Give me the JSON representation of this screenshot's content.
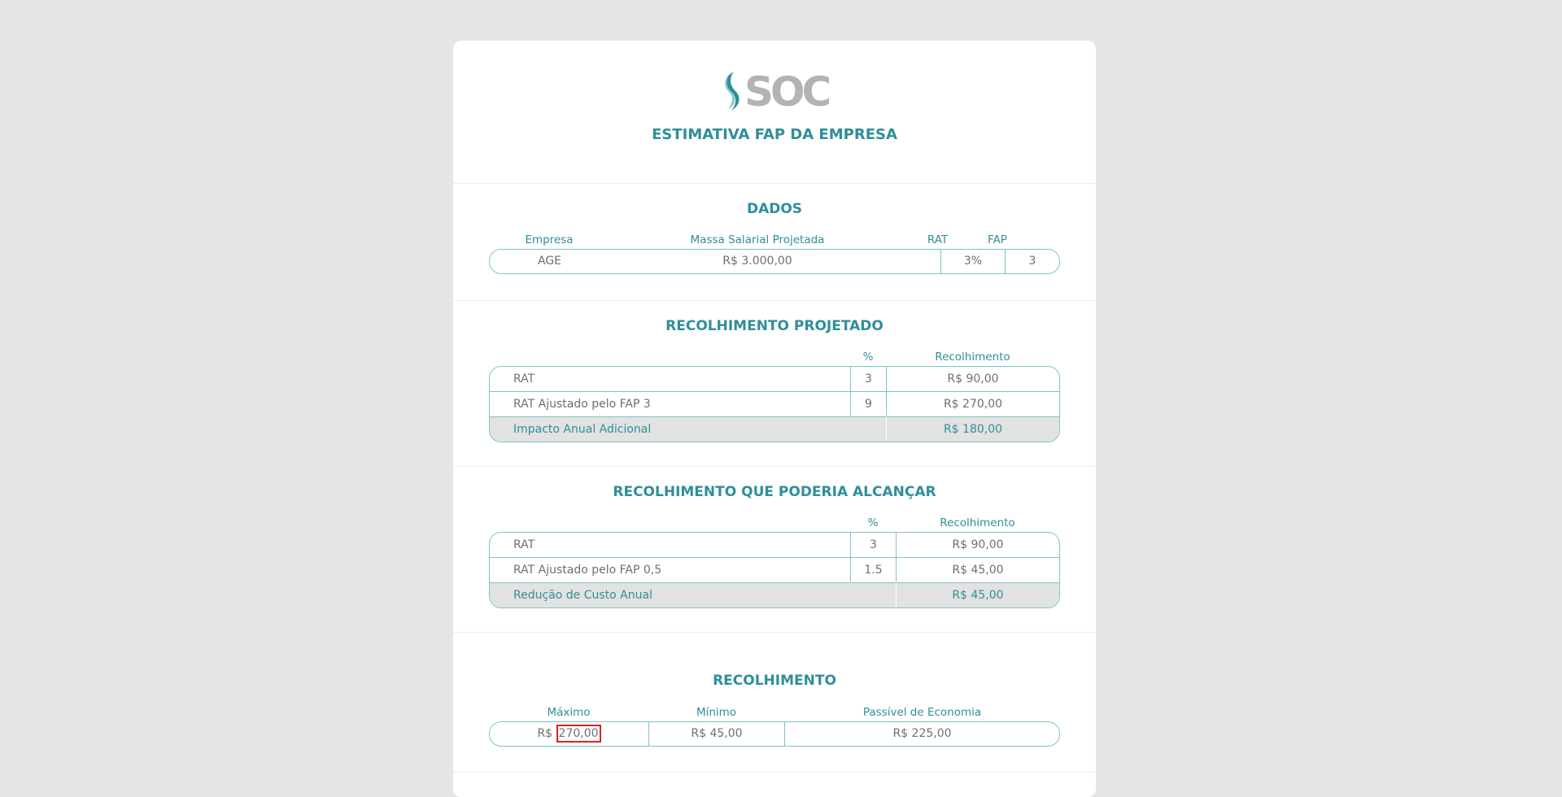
{
  "header": {
    "logo_text": "SOC",
    "title": "ESTIMATIVA FAP DA EMPRESA"
  },
  "dados": {
    "title": "DADOS",
    "headers": {
      "empresa": "Empresa",
      "massa": "Massa Salarial Projetada",
      "rat": "RAT",
      "fap": "FAP"
    },
    "values": {
      "empresa": "AGE",
      "massa": "R$ 3.000,00",
      "rat": "3%",
      "fap": "3"
    }
  },
  "projetado": {
    "title": "RECOLHIMENTO PROJETADO",
    "headers": {
      "pct": "%",
      "recolhimento": "Recolhimento"
    },
    "rows": [
      {
        "label": "RAT",
        "pct": "3",
        "value": "R$ 90,00"
      },
      {
        "label": "RAT Ajustado pelo FAP 3",
        "pct": "9",
        "value": "R$ 270,00"
      }
    ],
    "total": {
      "label": "Impacto Anual Adicional",
      "value": "R$ 180,00"
    }
  },
  "alcancar": {
    "title": "RECOLHIMENTO QUE PODERIA ALCANÇAR",
    "headers": {
      "pct": "%",
      "recolhimento": "Recolhimento"
    },
    "rows": [
      {
        "label": "RAT",
        "pct": "3",
        "value": "R$ 90,00"
      },
      {
        "label": "RAT Ajustado pelo FAP 0,5",
        "pct": "1.5",
        "value": "R$ 45,00"
      }
    ],
    "total": {
      "label": "Redução de Custo Anual",
      "value": "R$ 45,00"
    }
  },
  "recolhimento": {
    "title": "RECOLHIMENTO",
    "headers": {
      "maximo": "Máximo",
      "minimo": "Mínimo",
      "passivel": "Passível de Economia"
    },
    "values": {
      "maximo_prefix": "R$",
      "maximo_amount": "270,00",
      "minimo": "R$ 45,00",
      "passivel": "R$ 225,00"
    }
  },
  "colors": {
    "accent": "#2f8f98",
    "border": "#7fc2c6",
    "highlight": "#e02020"
  }
}
